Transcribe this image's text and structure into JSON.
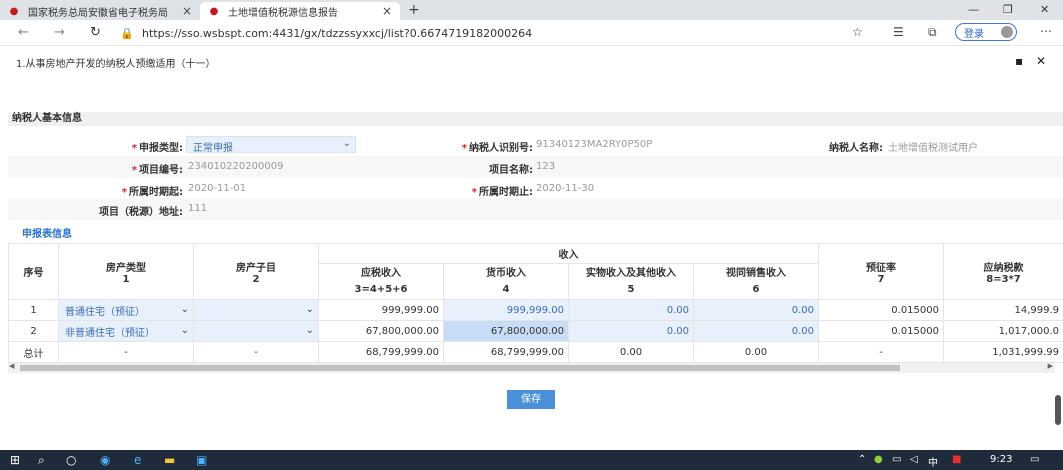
{
  "browser": {
    "tabs": [
      {
        "label": "国家税务总局安徽省电子税务局"
      },
      {
        "label": "土地增值税税源信息报告"
      }
    ],
    "url": "https://sso.wsbspt.com:4431/gx/tdzzssyxxcj/list?0.6674719182000264",
    "login_label": "登录"
  },
  "modal": {
    "title": "1.从事房地产开发的纳税人预缴适用（十一）"
  },
  "basic_info": {
    "section_title": "纳税人基本信息",
    "declare_type_label": "申报类型:",
    "declare_type_value": "正常申报",
    "taxpayer_id_label": "纳税人识别号:",
    "taxpayer_id_value": "91340123MA2RY0P50P",
    "taxpayer_name_label": "纳税人名称:",
    "taxpayer_name_value": "土地增值税测试用户",
    "project_no_label": "项目编号:",
    "project_no_value": "234010220200009",
    "project_name_label": "项目名称:",
    "project_name_value": "123",
    "period_start_label": "所属时期起:",
    "period_start_value": "2020-11-01",
    "period_end_label": "所属时期止:",
    "period_end_value": "2020-11-30",
    "address_label": "项目（税源）地址:",
    "address_value": "111"
  },
  "report": {
    "section_title": "申报表信息",
    "headers": {
      "seq": "序号",
      "house_type": "房产类型",
      "house_type_no": "1",
      "house_sub": "房产子目",
      "house_sub_no": "2",
      "income": "收入",
      "taxable_income": "应税收入",
      "taxable_formula": "3=4+5+6",
      "cash_income": "货币收入",
      "cash_no": "4",
      "kind_income": "实物收入及其他收入",
      "kind_no": "5",
      "deemed_income": "视同销售收入",
      "deemed_no": "6",
      "prepay_rate": "预征率",
      "prepay_no": "7",
      "tax_payable": "应纳税款",
      "tax_formula": "8=3*7"
    },
    "rows": [
      {
        "seq": "1",
        "house_type": "普通住宅（预征）",
        "house_sub": "",
        "taxable": "999,999.00",
        "cash": "999,999.00",
        "kind": "0.00",
        "deemed": "0.00",
        "rate": "0.015000",
        "tax": "14,999.9"
      },
      {
        "seq": "2",
        "house_type": "非普通住宅（预征）",
        "house_sub": "",
        "taxable": "67,800,000.00",
        "cash": "67,800,000.00",
        "kind": "0.00",
        "deemed": "0.00",
        "rate": "0.015000",
        "tax": "1,017,000.0"
      }
    ],
    "total": {
      "seq": "总计",
      "house_type": "-",
      "house_sub": "-",
      "taxable": "68,799,999.00",
      "cash": "68,799,999.00",
      "kind": "0.00",
      "deemed": "0.00",
      "rate": "-",
      "tax": "1,031,999.99"
    }
  },
  "save_label": "保存",
  "taskbar": {
    "ime": "中",
    "time": "9:23"
  }
}
